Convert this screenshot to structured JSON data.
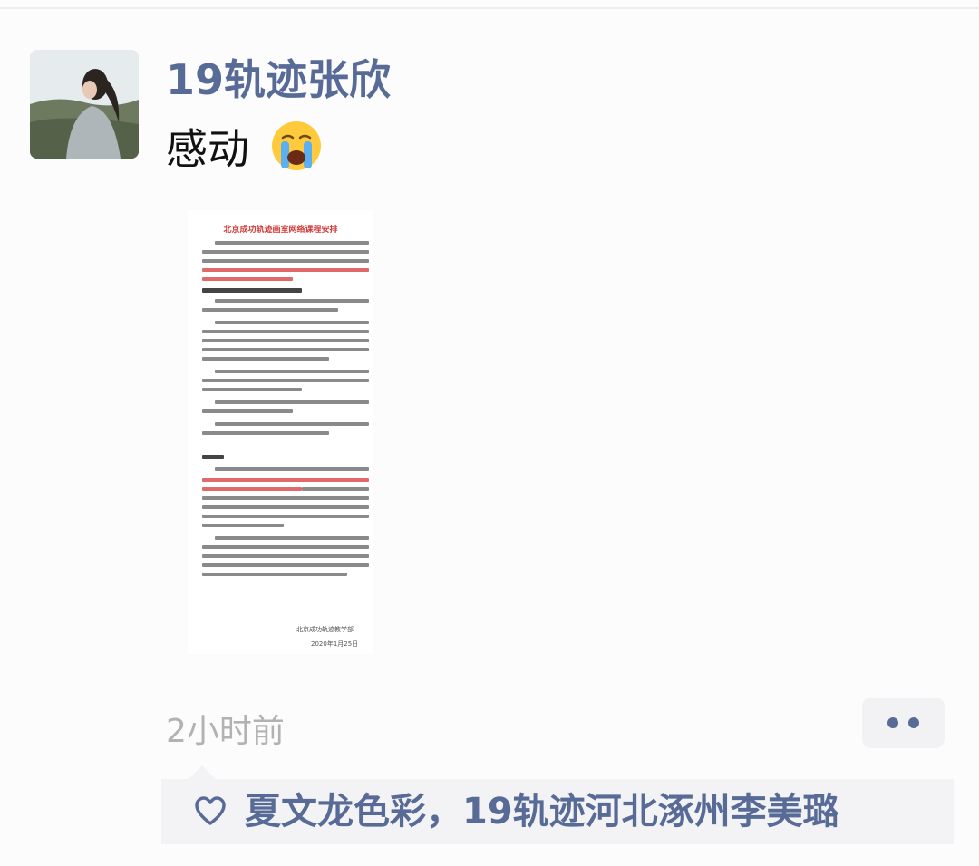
{
  "post": {
    "username": "19轨迹张欣",
    "text": "感动",
    "emoji_icon": "loudly-crying-face-icon",
    "time": "2小时前",
    "more_icon": "two-dots-icon"
  },
  "attached_document": {
    "title": "北京成功轨迹画室网络课程安排",
    "signature_org": "北京成功轨迹教学部",
    "signature_date": "2020年1月25日"
  },
  "likes": {
    "icon": "heart-outline-icon",
    "names": "夏文龙色彩，19轨迹河北涿州李美璐"
  },
  "colors": {
    "link_blue": "#586b97",
    "time_gray": "#b2b2b2",
    "likes_bg": "#f3f3f5"
  }
}
